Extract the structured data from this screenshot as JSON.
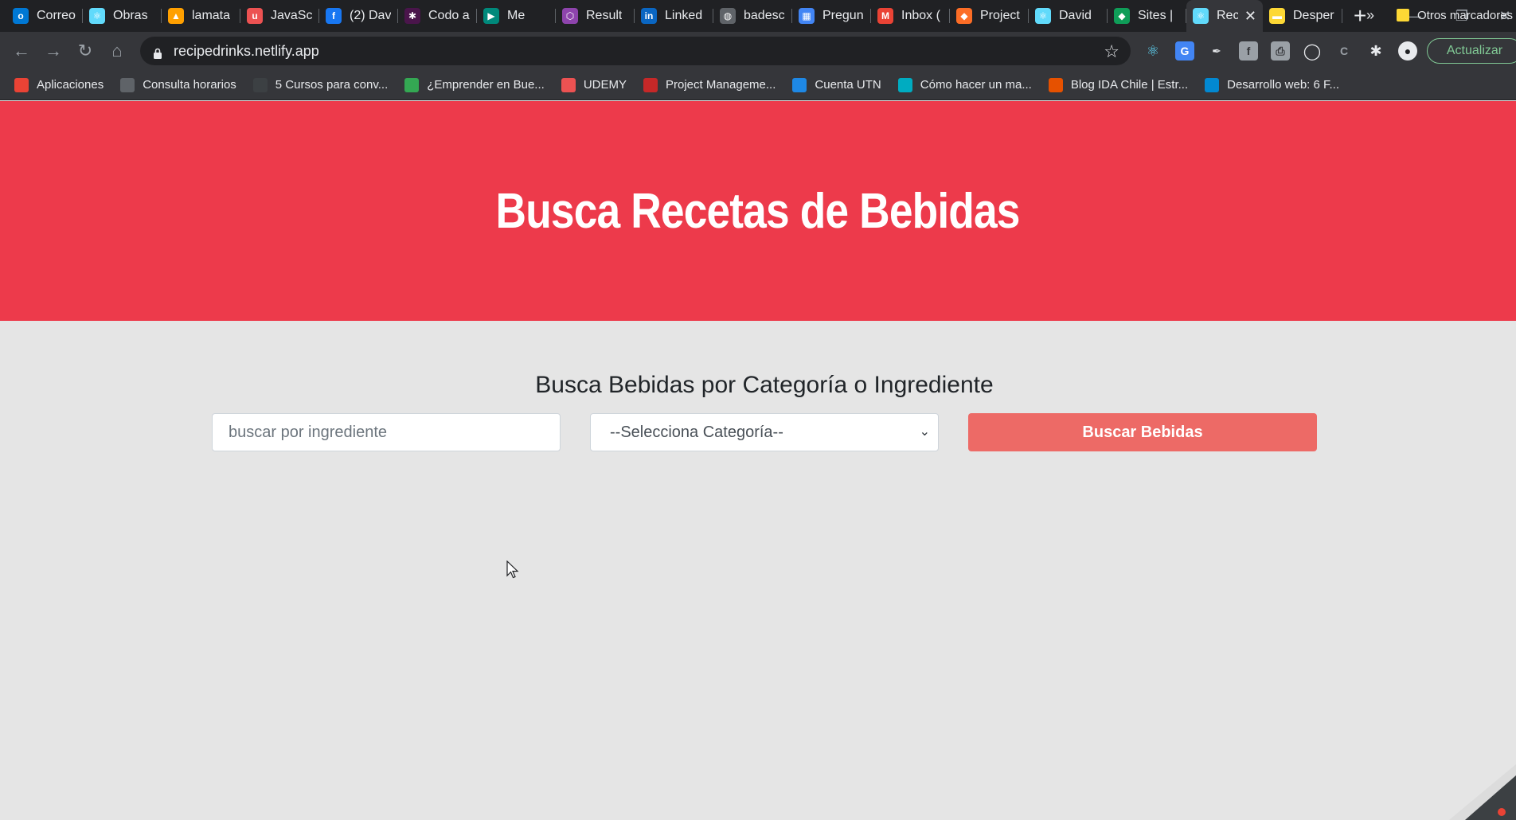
{
  "browser": {
    "tabs": [
      {
        "label": "Correo",
        "icon": "outlook-icon",
        "color": "#0078d4",
        "glyph": "o"
      },
      {
        "label": "Obras",
        "icon": "react-icon",
        "color": "#61dafb",
        "glyph": "⚛"
      },
      {
        "label": "lamata",
        "icon": "firebase-icon",
        "color": "#ffa000",
        "glyph": "▲"
      },
      {
        "label": "JavaSc",
        "icon": "udemy-icon",
        "color": "#ec5252",
        "glyph": "u"
      },
      {
        "label": "(2) Dav",
        "icon": "facebook-icon",
        "color": "#1877f2",
        "glyph": "f"
      },
      {
        "label": "Codo a",
        "icon": "slack-icon",
        "color": "#4a154b",
        "glyph": "✱"
      },
      {
        "label": "Me",
        "icon": "meet-icon",
        "color": "#00897b",
        "glyph": "▶"
      },
      {
        "label": "Result",
        "icon": "hexagon-icon",
        "color": "#8e44ad",
        "glyph": "⬡"
      },
      {
        "label": "Linked",
        "icon": "linkedin-icon",
        "color": "#0a66c2",
        "glyph": "in"
      },
      {
        "label": "badesc",
        "icon": "globe-icon",
        "color": "#5f6368",
        "glyph": "◍"
      },
      {
        "label": "Pregun",
        "icon": "forms-icon",
        "color": "#4285f4",
        "glyph": "▦"
      },
      {
        "label": "Inbox (",
        "icon": "gmail-icon",
        "color": "#ea4335",
        "glyph": "M"
      },
      {
        "label": "Project",
        "icon": "gitlab-icon",
        "color": "#fc6d26",
        "glyph": "◆"
      },
      {
        "label": "David",
        "icon": "react-icon",
        "color": "#61dafb",
        "glyph": "⚛"
      },
      {
        "label": "Sites |",
        "icon": "sites-icon",
        "color": "#0f9d58",
        "glyph": "◆"
      },
      {
        "label": "Rec",
        "icon": "react-icon",
        "color": "#61dafb",
        "glyph": "⚛",
        "active": true
      },
      {
        "label": "Desper",
        "icon": "bookmark-stripe-icon",
        "color": "#fdd835",
        "glyph": "▬"
      }
    ],
    "address": "recipedrinks.netlify.app",
    "update_label": "Actualizar",
    "bookmarks": [
      {
        "label": "Aplicaciones",
        "icon": "apps-grid-icon",
        "color": "#ea4335"
      },
      {
        "label": "Consulta horarios",
        "icon": "globe-icon",
        "color": "#5f6368"
      },
      {
        "label": "5 Cursos para conv...",
        "icon": "cloud-icon",
        "color": "#3c4043"
      },
      {
        "label": "¿Emprender en Bue...",
        "icon": "leaf-icon",
        "color": "#34a853"
      },
      {
        "label": "UDEMY",
        "icon": "udemy-icon",
        "color": "#ec5252"
      },
      {
        "label": "Project Manageme...",
        "icon": "dash-icon",
        "color": "#c62828"
      },
      {
        "label": "Cuenta UTN",
        "icon": "utn-icon",
        "color": "#1e88e5"
      },
      {
        "label": "Cómo hacer un ma...",
        "icon": "s-icon",
        "color": "#00acc1"
      },
      {
        "label": "Blog IDA Chile | Estr...",
        "icon": "ida-icon",
        "color": "#e65100"
      },
      {
        "label": "Desarrollo web: 6 F...",
        "icon": "window-icon",
        "color": "#0288d1"
      }
    ],
    "bookmarks_more": "»",
    "other_bookmarks": "Otros marcadores"
  },
  "page": {
    "title": "Busca Recetas de Bebidas",
    "subtitle": "Busca Bebidas por Categoría o Ingrediente",
    "search_placeholder": "buscar por ingrediente",
    "category_selected": "--Selecciona Categoría--",
    "submit_label": "Buscar Bebidas"
  },
  "colors": {
    "hero_bg": "#ed3a4b",
    "button_bg": "#ed6a66",
    "page_bg": "#e5e5e5"
  }
}
